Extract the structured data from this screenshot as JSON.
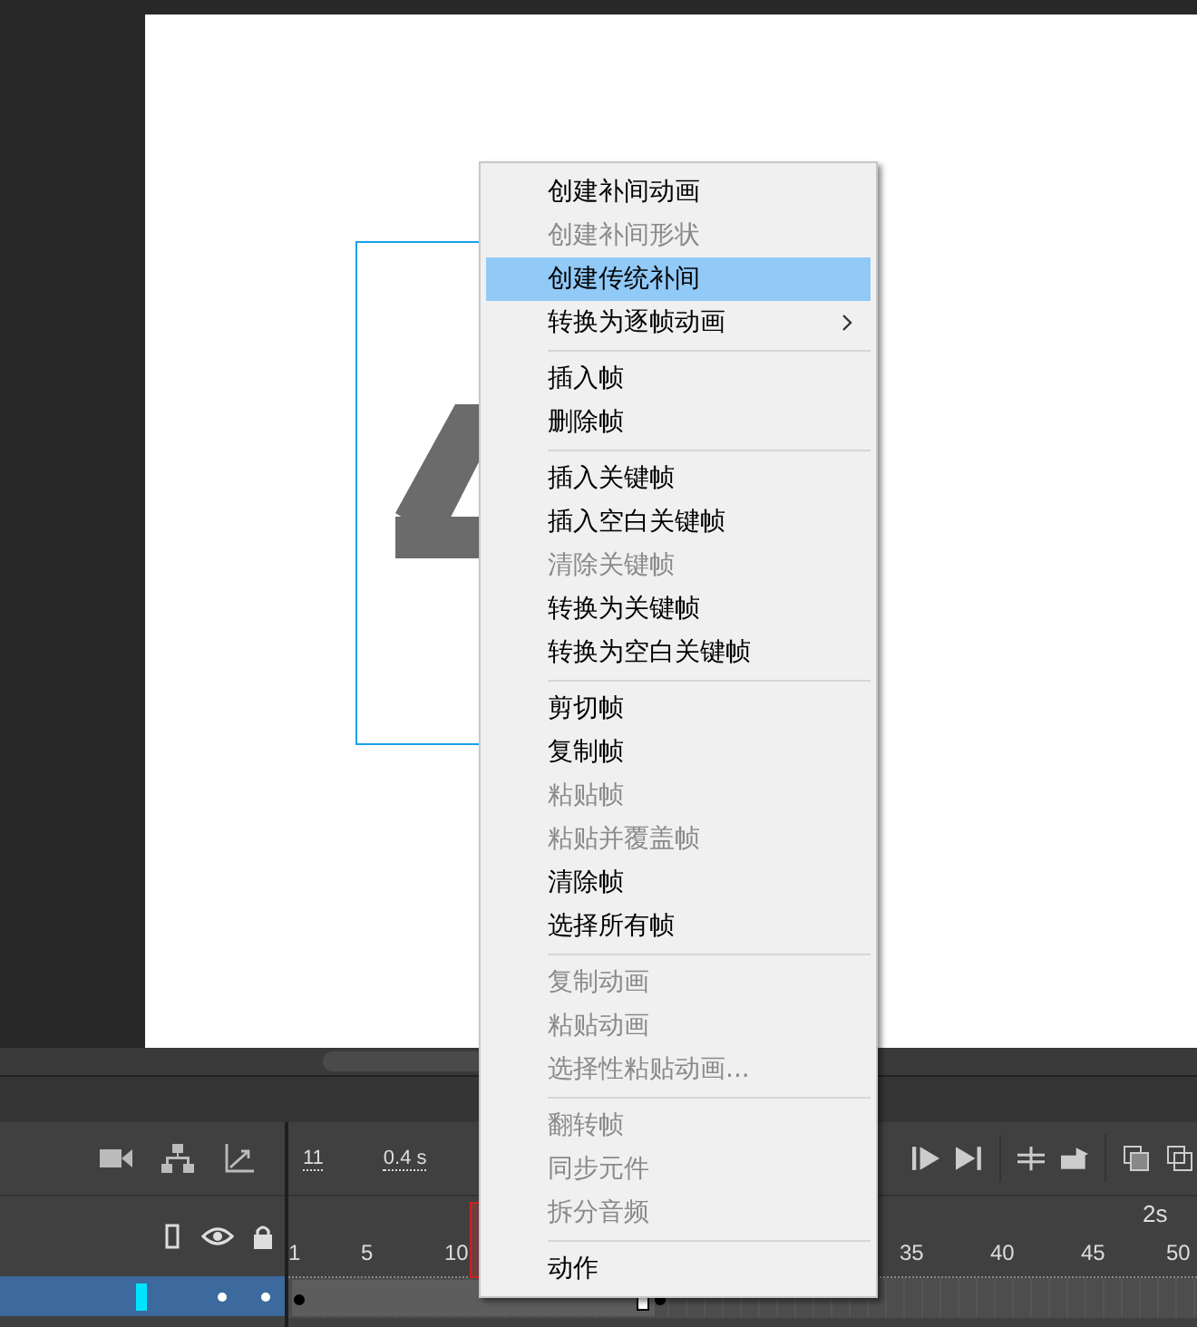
{
  "timeline": {
    "frame_number": "11",
    "time": "0.4 s",
    "ruler_labels": [
      {
        "text": "1",
        "kind": "frame"
      },
      {
        "text": "5",
        "kind": "frame"
      },
      {
        "text": "10",
        "kind": "frame"
      },
      {
        "text": "35",
        "kind": "frame"
      },
      {
        "text": "40",
        "kind": "frame"
      },
      {
        "text": "45",
        "kind": "frame"
      },
      {
        "text": "50",
        "kind": "frame"
      },
      {
        "text": "2s",
        "kind": "second"
      }
    ],
    "layers": [
      {
        "selected": true
      }
    ]
  },
  "context_menu": {
    "groups": [
      [
        {
          "label": "创建补间动画",
          "disabled": false,
          "selected": false
        },
        {
          "label": "创建补间形状",
          "disabled": true,
          "selected": false
        },
        {
          "label": "创建传统补间",
          "disabled": false,
          "selected": true
        },
        {
          "label": "转换为逐帧动画",
          "disabled": false,
          "selected": false,
          "submenu": true
        }
      ],
      [
        {
          "label": "插入帧",
          "disabled": false,
          "selected": false
        },
        {
          "label": "删除帧",
          "disabled": false,
          "selected": false
        }
      ],
      [
        {
          "label": "插入关键帧",
          "disabled": false,
          "selected": false
        },
        {
          "label": "插入空白关键帧",
          "disabled": false,
          "selected": false
        },
        {
          "label": "清除关键帧",
          "disabled": true,
          "selected": false
        },
        {
          "label": "转换为关键帧",
          "disabled": false,
          "selected": false
        },
        {
          "label": "转换为空白关键帧",
          "disabled": false,
          "selected": false
        }
      ],
      [
        {
          "label": "剪切帧",
          "disabled": false,
          "selected": false
        },
        {
          "label": "复制帧",
          "disabled": false,
          "selected": false
        },
        {
          "label": "粘贴帧",
          "disabled": true,
          "selected": false
        },
        {
          "label": "粘贴并覆盖帧",
          "disabled": true,
          "selected": false
        },
        {
          "label": "清除帧",
          "disabled": false,
          "selected": false
        },
        {
          "label": "选择所有帧",
          "disabled": false,
          "selected": false
        }
      ],
      [
        {
          "label": "复制动画",
          "disabled": true,
          "selected": false
        },
        {
          "label": "粘贴动画",
          "disabled": true,
          "selected": false
        },
        {
          "label": "选择性粘贴动画...",
          "disabled": true,
          "selected": false
        }
      ],
      [
        {
          "label": "翻转帧",
          "disabled": true,
          "selected": false
        },
        {
          "label": "同步元件",
          "disabled": true,
          "selected": false
        },
        {
          "label": "拆分音频",
          "disabled": true,
          "selected": false
        }
      ],
      [
        {
          "label": "动作",
          "disabled": false,
          "selected": false
        }
      ]
    ]
  }
}
